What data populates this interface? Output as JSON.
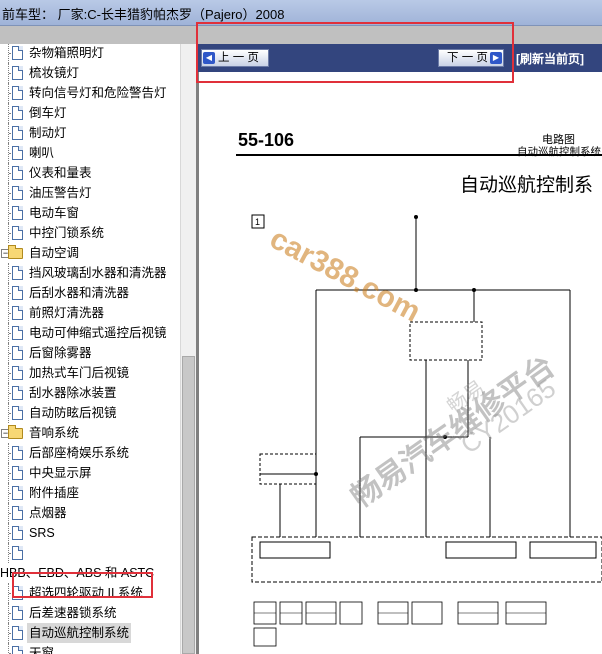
{
  "window": {
    "title": "前车型： 厂家:C-长丰猎豹帕杰罗（Pajero）2008"
  },
  "tree": {
    "items": [
      {
        "label": "杂物箱照明灯",
        "kind": "doc"
      },
      {
        "label": "梳妆镜灯",
        "kind": "doc"
      },
      {
        "label": "转向信号灯和危险警告灯",
        "kind": "doc"
      },
      {
        "label": "倒车灯",
        "kind": "doc"
      },
      {
        "label": "制动灯",
        "kind": "doc"
      },
      {
        "label": "喇叭",
        "kind": "doc"
      },
      {
        "label": "仪表和量表",
        "kind": "doc"
      },
      {
        "label": "油压警告灯",
        "kind": "doc"
      },
      {
        "label": "电动车窗",
        "kind": "doc"
      },
      {
        "label": "中控门锁系统",
        "kind": "doc"
      },
      {
        "label": "自动空调",
        "kind": "folder"
      },
      {
        "label": "挡风玻璃刮水器和清洗器",
        "kind": "doc"
      },
      {
        "label": "后刮水器和清洗器",
        "kind": "doc"
      },
      {
        "label": "前照灯清洗器",
        "kind": "doc"
      },
      {
        "label": "电动可伸缩式遥控后视镜",
        "kind": "doc"
      },
      {
        "label": "后窗除雾器",
        "kind": "doc"
      },
      {
        "label": "加热式车门后视镜",
        "kind": "doc"
      },
      {
        "label": "刮水器除冰装置",
        "kind": "doc"
      },
      {
        "label": "自动防眩后视镜",
        "kind": "doc"
      },
      {
        "label": "音响系统",
        "kind": "folder"
      },
      {
        "label": "后部座椅娱乐系统",
        "kind": "doc"
      },
      {
        "label": "中央显示屏",
        "kind": "doc"
      },
      {
        "label": "附件插座",
        "kind": "doc"
      },
      {
        "label": "点烟器",
        "kind": "doc"
      },
      {
        "label": "SRS",
        "kind": "doc"
      },
      {
        "label": "",
        "kind": "doc"
      },
      {
        "label": "HBB、EBD、ABS 和 ASTC",
        "kind": "flat"
      },
      {
        "label": "超选四轮驱动 II 系统",
        "kind": "doc"
      },
      {
        "label": "后差速器锁系统",
        "kind": "doc"
      },
      {
        "label": "自动巡航控制系统",
        "kind": "doc",
        "selected": true
      },
      {
        "label": "天窗",
        "kind": "doc"
      }
    ]
  },
  "nav": {
    "prev_label": "上 一 页",
    "next_label": "下 一 页",
    "refresh_label": "[刷新当前页]"
  },
  "document": {
    "page_number": "55-106",
    "category": "电路图",
    "system": "自动巡航控制系统",
    "title": "自动巡航控制系",
    "watermarks": [
      "car388.com",
      "畅易汽车维修平台",
      "CY20165",
      "畅易"
    ]
  },
  "colors": {
    "navbar": "#33457e",
    "highlight": "#e0303a",
    "titlebar": "#9fb3d8"
  }
}
